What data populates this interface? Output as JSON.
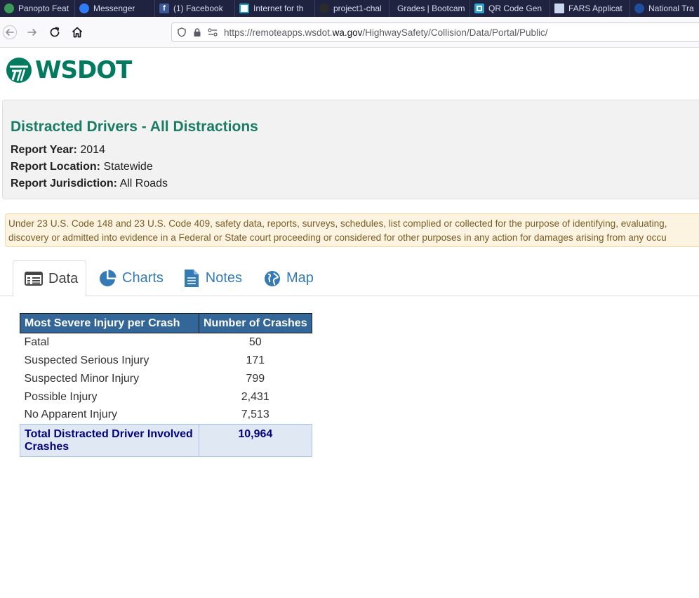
{
  "bookmarks": [
    {
      "label": "Panopto Feat",
      "color": "#3a9a5a",
      "icon": "panopto-icon"
    },
    {
      "label": "Messenger",
      "color": "#2f7cf6",
      "icon": "messenger-icon"
    },
    {
      "label": "(1) Facebook",
      "color": "#3b5998",
      "icon": "facebook-icon"
    },
    {
      "label": "Internet for th",
      "color": "#1aa3c8",
      "icon": "cisco-icon"
    },
    {
      "label": "project1-chal",
      "color": "#2b2b2b",
      "icon": "github-icon"
    },
    {
      "label": "Grades | Bootcam",
      "color": "#202340",
      "icon": "none"
    },
    {
      "label": "QR Code Gen",
      "color": "#26a6d1",
      "icon": "qr-icon"
    },
    {
      "label": "FARS Applicat",
      "color": "#c9d7ee",
      "icon": "document-icon"
    },
    {
      "label": "National Tra",
      "color": "#1f4e9e",
      "icon": "nhtsa-icon"
    }
  ],
  "address": {
    "prefix": "https://remoteapps.wsdot.",
    "domain": "wa.gov",
    "path": "/HighwaySafety/Collision/Data/Portal/Public/"
  },
  "logo": {
    "text": "WSDOT"
  },
  "report": {
    "title": "Distracted Drivers - All Distractions",
    "year_label": "Report Year:",
    "year_value": "2014",
    "location_label": "Report Location:",
    "location_value": "Statewide",
    "jurisdiction_label": "Report Jurisdiction:",
    "jurisdiction_value": "All Roads"
  },
  "disclaimer": {
    "line1": "Under 23 U.S. Code 148 and 23 U.S. Code 409, safety data, reports, surveys, schedules, list complied or collected for the purpose of identifying, evaluating,",
    "line2": "discovery or admitted into evidence in a Federal or State court proceeding or considered for other purposes in any action for damages arising from any occu"
  },
  "tabs": [
    {
      "label": "Data",
      "icon": "table-icon"
    },
    {
      "label": "Charts",
      "icon": "pie-chart-icon"
    },
    {
      "label": "Notes",
      "icon": "document-icon"
    },
    {
      "label": "Map",
      "icon": "globe-icon"
    }
  ],
  "table": {
    "headers": [
      "Most Severe Injury per Crash",
      "Number of Crashes"
    ],
    "rows": [
      {
        "label": "Fatal",
        "value": "50"
      },
      {
        "label": "Suspected Serious Injury",
        "value": "171"
      },
      {
        "label": "Suspected Minor Injury",
        "value": "799"
      },
      {
        "label": "Possible Injury",
        "value": "2,431"
      },
      {
        "label": "No Apparent Injury",
        "value": "7,513"
      }
    ],
    "total_label_line1": "Total Distracted Driver Involved",
    "total_label_line2": "Crashes",
    "total_value": "10,964"
  },
  "colors": {
    "tab_strip": "#202340",
    "brand_green": "#007b5f",
    "title_green": "#1a7c64",
    "link_blue": "#337ab7",
    "table_header": "#336699",
    "total_row_bg": "#e0e8f4",
    "total_text": "#000080"
  }
}
